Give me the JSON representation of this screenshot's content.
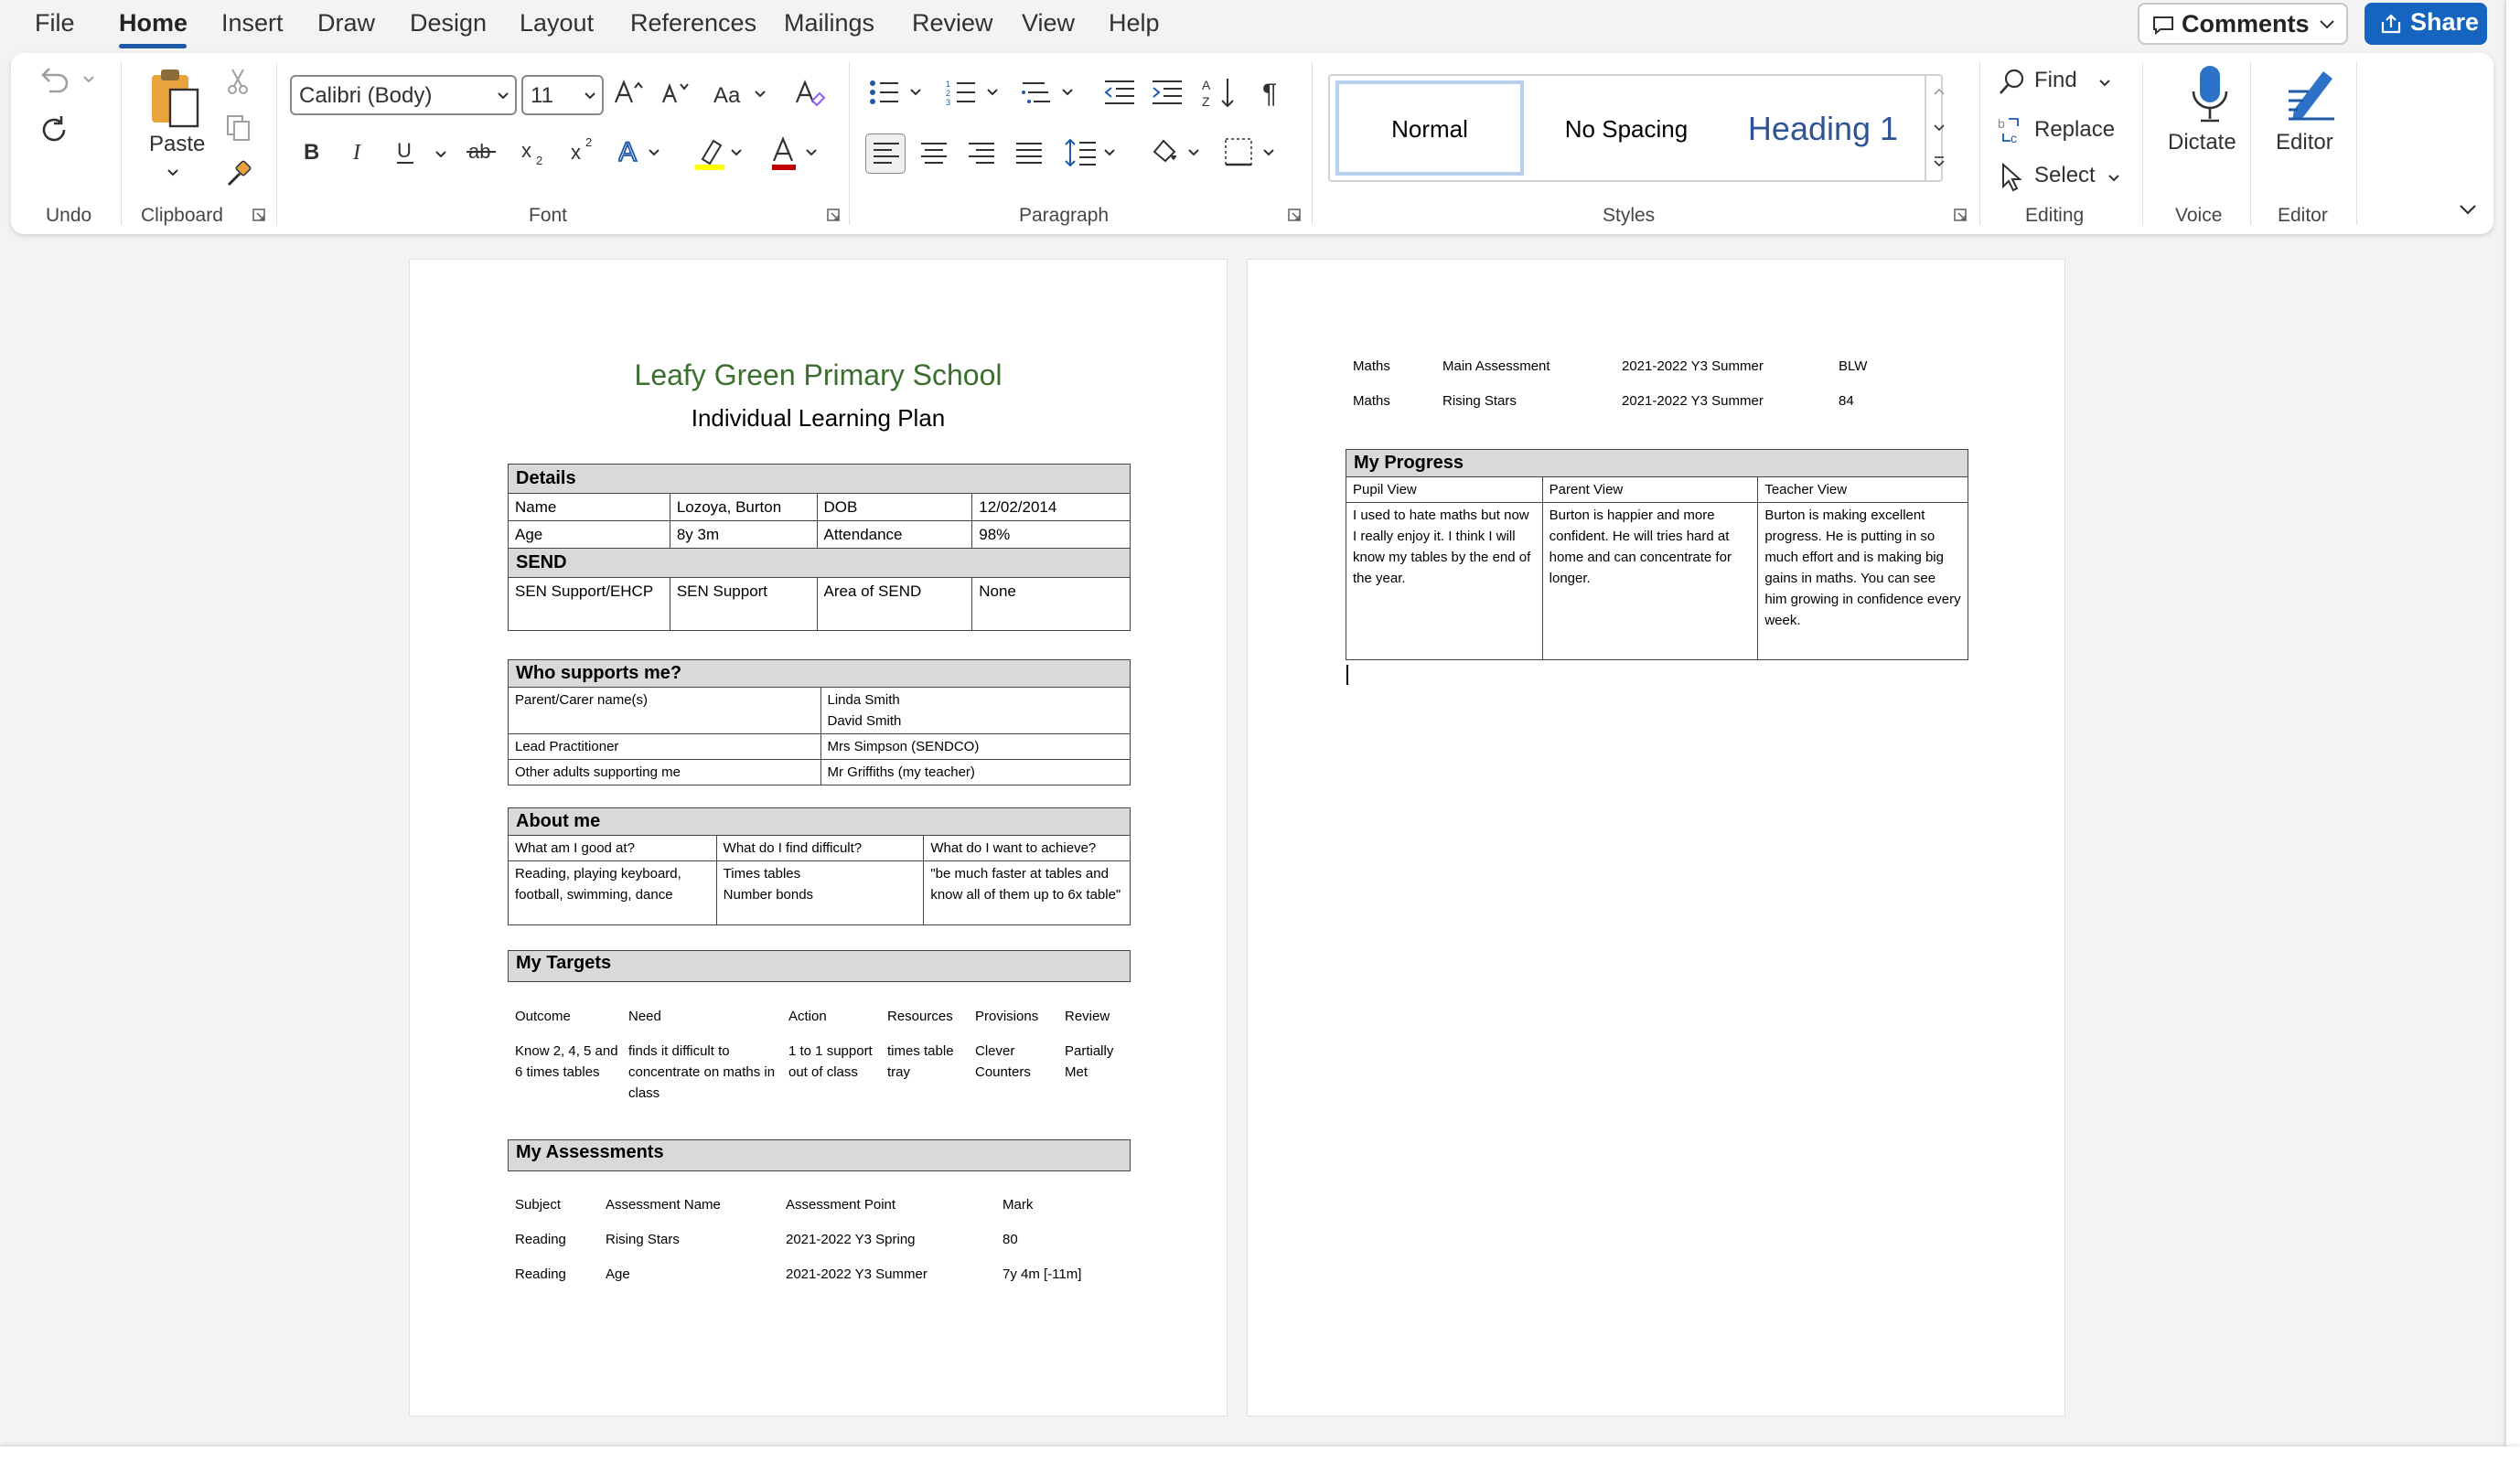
{
  "menu": {
    "items": [
      "File",
      "Home",
      "Insert",
      "Draw",
      "Design",
      "Layout",
      "References",
      "Mailings",
      "Review",
      "View",
      "Help"
    ],
    "active": "Home",
    "comments_label": "Comments",
    "share_label": "Share"
  },
  "ribbon": {
    "groups": {
      "undo": "Undo",
      "clipboard": "Clipboard",
      "font": "Font",
      "paragraph": "Paragraph",
      "styles": "Styles",
      "editing": "Editing",
      "voice": "Voice",
      "editor": "Editor"
    },
    "paste_label": "Paste",
    "font_name": "Calibri (Body)",
    "font_size": "11",
    "styles": [
      "Normal",
      "No Spacing",
      "Heading 1"
    ],
    "find_label": "Find",
    "replace_label": "Replace",
    "select_label": "Select",
    "dictate_label": "Dictate",
    "editor_label": "Editor",
    "colors": {
      "accent": "#1464c0",
      "highlight": "#ffff00",
      "font_color": "#c00000"
    }
  },
  "page1": {
    "title": "Leafy Green Primary School",
    "subtitle": "Individual Learning Plan",
    "details": {
      "header": "Details",
      "name_label": "Name",
      "name_value": "Lozoya, Burton",
      "dob_label": "DOB",
      "dob_value": "12/02/2014",
      "age_label": "Age",
      "age_value": "8y 3m",
      "attendance_label": "Attendance",
      "attendance_value": "98%",
      "send_header": "SEND",
      "sen_label": "SEN Support/EHCP",
      "sen_value": "SEN Support",
      "area_label": "Area of SEND",
      "area_value": "None"
    },
    "supports": {
      "header": "Who supports me?",
      "parent_label": "Parent/Carer name(s)",
      "parent_1": "Linda Smith",
      "parent_2": "David Smith",
      "lead_label": "Lead Practitioner",
      "lead_value": "Mrs Simpson (SENDCO)",
      "other_label": "Other adults supporting me",
      "other_value": "Mr Griffiths (my teacher)"
    },
    "about": {
      "header": "About me",
      "col1": "What am I good at?",
      "col2": "What do I find difficult?",
      "col3": "What do I want to achieve?",
      "good_at": "Reading, playing keyboard, football, swimming, dance",
      "difficult_1": "Times tables",
      "difficult_2": "Number bonds",
      "achieve": "\"be much faster at tables and know all of them up to 6x table\""
    },
    "targets": {
      "header": "My Targets",
      "columns": [
        "Outcome",
        "Need",
        "Action",
        "Resources",
        "Provisions",
        "Review"
      ],
      "row": [
        "Know 2, 4, 5 and 6 times tables",
        "finds it difficult to concentrate on maths in class",
        "1 to 1 support out of class",
        "times table tray",
        "Clever Counters",
        "Partially Met"
      ]
    },
    "assessments": {
      "header": "My Assessments",
      "columns": [
        "Subject",
        "Assessment Name",
        "Assessment Point",
        "Mark"
      ],
      "rows": [
        [
          "Reading",
          "Rising Stars",
          "2021-2022 Y3 Spring",
          "80"
        ],
        [
          "Reading",
          "Age",
          "2021-2022 Y3 Summer",
          "7y 4m [-11m]"
        ]
      ]
    }
  },
  "page2": {
    "assessments_cont": [
      [
        "Maths",
        "Main Assessment",
        "2021-2022 Y3 Summer",
        "BLW"
      ],
      [
        "Maths",
        "Rising Stars",
        "2021-2022 Y3 Summer",
        "84"
      ]
    ],
    "progress": {
      "header": "My Progress",
      "col1": "Pupil View",
      "col2": "Parent View",
      "col3": "Teacher View",
      "pupil": "I used to hate maths but now I really enjoy it. I think I will know my tables by the end of the year.",
      "parent": "Burton is happier and more confident. He will tries hard at home and can concentrate for longer.",
      "teacher": "Burton is making excellent progress. He is putting in so much effort and is making big gains in maths. You can see him growing in confidence every week."
    }
  }
}
